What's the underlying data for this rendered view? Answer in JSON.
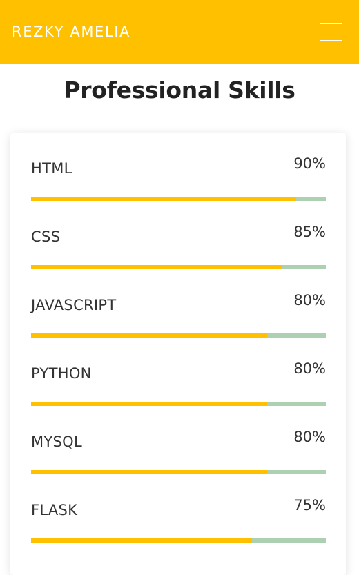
{
  "header": {
    "brand": "REZKY AMELIA",
    "menu_icon": "hamburger-menu-icon",
    "bg_color": "#FFC000"
  },
  "section": {
    "title": "Professional Skills"
  },
  "colors": {
    "bar_fill": "#FFC000",
    "bar_track": "#ADD0B3"
  },
  "skills": [
    {
      "name": "HTML",
      "percent_label": "90%",
      "value": 90
    },
    {
      "name": "CSS",
      "percent_label": "85%",
      "value": 85
    },
    {
      "name": "JAVASCRIPT",
      "percent_label": "80%",
      "value": 80
    },
    {
      "name": "PYTHON",
      "percent_label": "80%",
      "value": 80
    },
    {
      "name": "MYSQL",
      "percent_label": "80%",
      "value": 80
    },
    {
      "name": "FLASK",
      "percent_label": "75%",
      "value": 75
    }
  ]
}
